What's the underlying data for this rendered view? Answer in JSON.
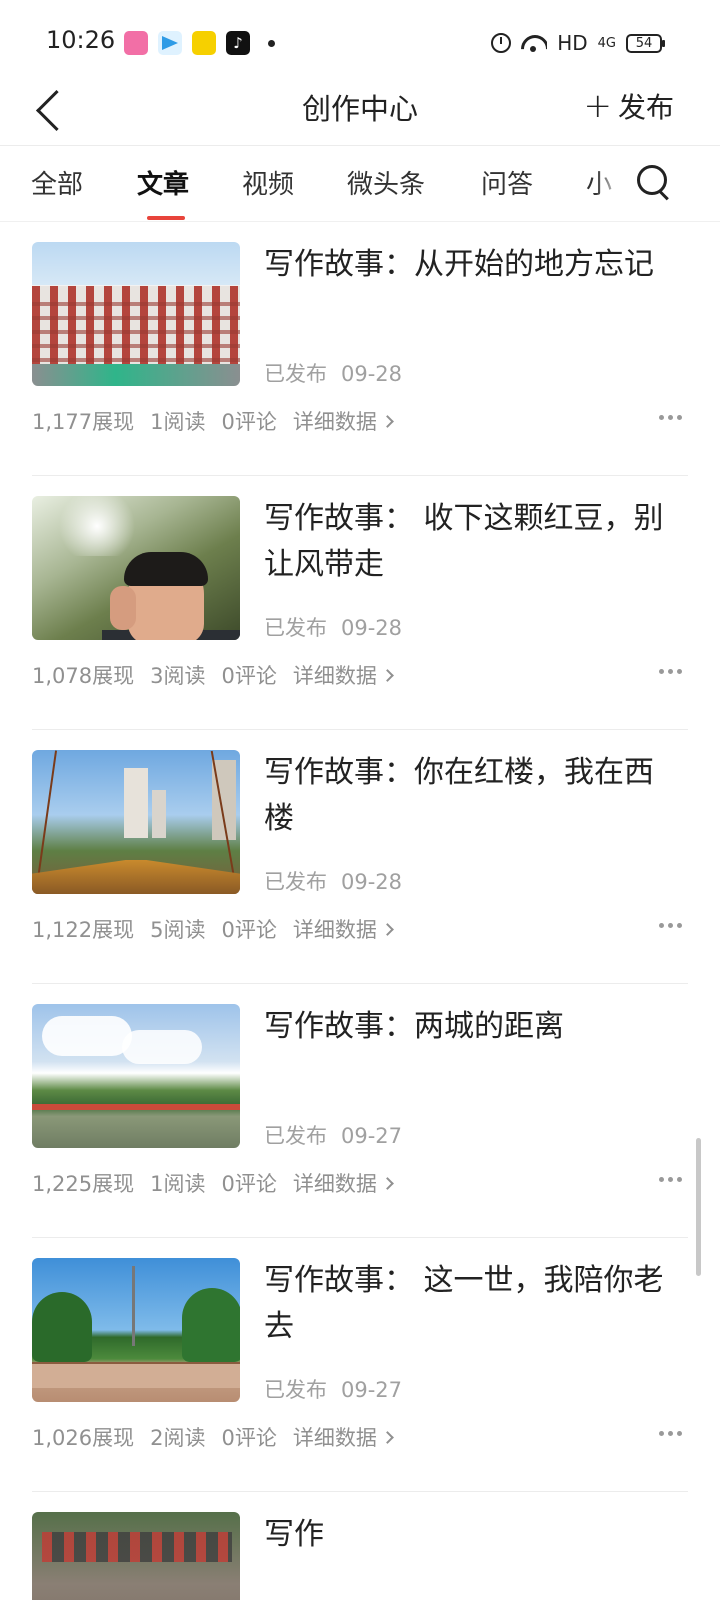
{
  "status_bar": {
    "time": "10:26",
    "hd_label": "HD",
    "signal_label": "4G",
    "battery": "54",
    "app_icons": [
      "bilibili-icon",
      "paper-plane-icon",
      "toutiao-icon",
      "tiktok-icon"
    ]
  },
  "nav": {
    "title": "创作中心",
    "publish_label": "发布"
  },
  "tabs": [
    {
      "label": "全部",
      "active": false
    },
    {
      "label": "文章",
      "active": true
    },
    {
      "label": "视频",
      "active": false
    },
    {
      "label": "微头条",
      "active": false
    },
    {
      "label": "问答",
      "active": false
    },
    {
      "label": "小",
      "active": false
    }
  ],
  "articles": [
    {
      "title": "写作故事：从开始的地方忘记",
      "status": "已发布",
      "date": "09-28",
      "views": "1,177展现",
      "reads": "1阅读",
      "comments": "0评论",
      "detail": "详细数据"
    },
    {
      "title": "写作故事： 收下这颗红豆，别让风带走",
      "status": "已发布",
      "date": "09-28",
      "views": "1,078展现",
      "reads": "3阅读",
      "comments": "0评论",
      "detail": "详细数据"
    },
    {
      "title": "写作故事：你在红楼，我在西楼",
      "status": "已发布",
      "date": "09-28",
      "views": "1,122展现",
      "reads": "5阅读",
      "comments": "0评论",
      "detail": "详细数据"
    },
    {
      "title": "写作故事：两城的距离",
      "status": "已发布",
      "date": "09-27",
      "views": "1,225展现",
      "reads": "1阅读",
      "comments": "0评论",
      "detail": "详细数据"
    },
    {
      "title": "写作故事： 这一世，我陪你老去",
      "status": "已发布",
      "date": "09-27",
      "views": "1,026展现",
      "reads": "2阅读",
      "comments": "0评论",
      "detail": "详细数据"
    },
    {
      "title": "写作"
    }
  ],
  "colors": {
    "accent": "#e8443b",
    "meta_text": "#909090"
  }
}
